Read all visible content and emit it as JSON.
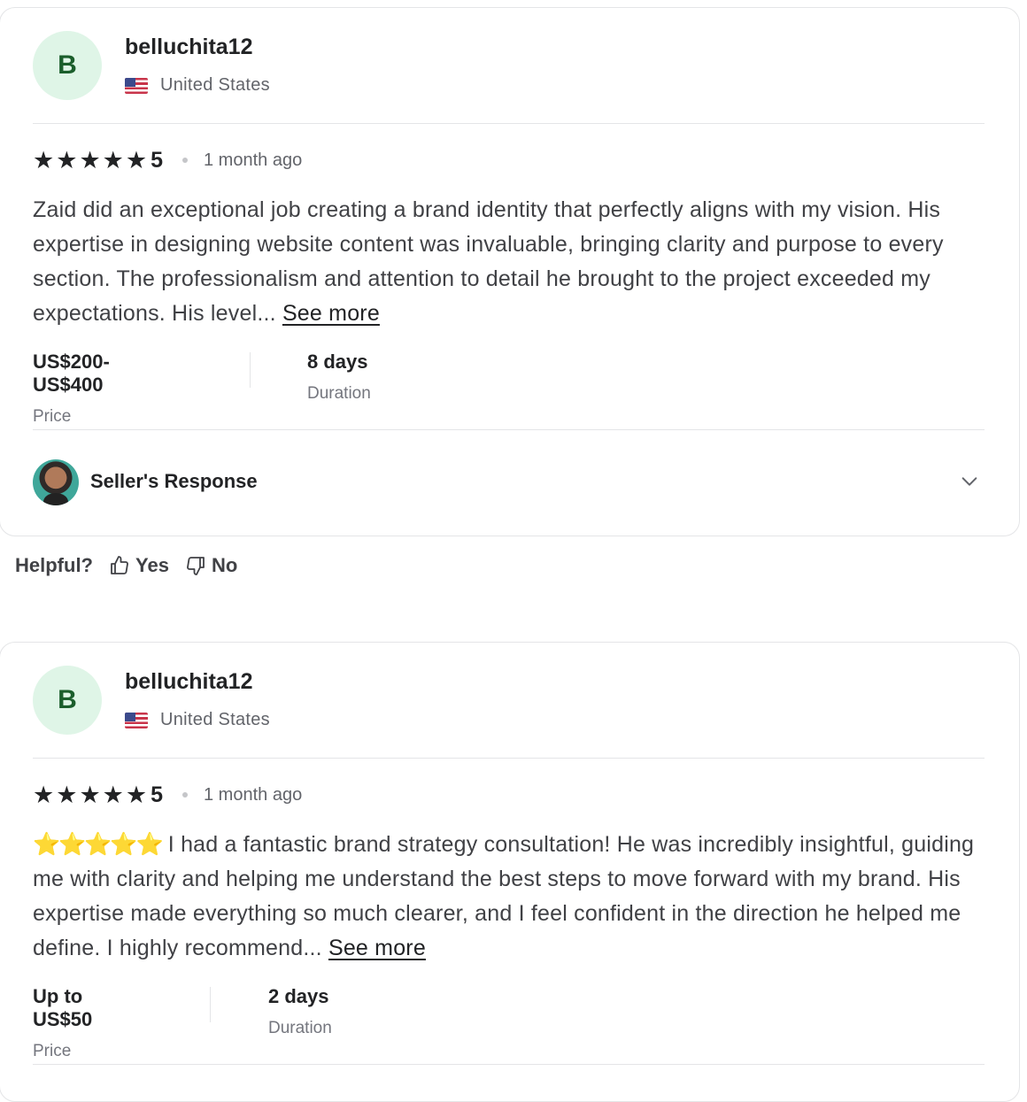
{
  "reviews": [
    {
      "avatar_letter": "B",
      "username": "belluchita12",
      "country": "United States",
      "rating": "5",
      "time_ago": "1 month ago",
      "text": "Zaid did an exceptional job creating a brand identity that perfectly aligns with my vision. His expertise in designing website content was invaluable, bringing clarity and purpose to every section. The professionalism and attention to detail he brought to the project exceeded my expectations. His level...",
      "see_more": "See more",
      "price_value": "US$200-US$400",
      "price_label": "Price",
      "duration_value": "8 days",
      "duration_label": "Duration",
      "seller_response_label": "Seller's Response"
    },
    {
      "avatar_letter": "B",
      "username": "belluchita12",
      "country": "United States",
      "rating": "5",
      "time_ago": "1 month ago",
      "text_emoji": "⭐⭐⭐⭐⭐",
      "text": " I had a fantastic brand strategy consultation! He was incredibly insightful, guiding me with clarity and helping me understand the best steps to move forward with my brand. His expertise made everything so much clearer, and I feel confident in the direction he helped me define. I highly recommend...",
      "see_more": "See more",
      "price_value": "Up to US$50",
      "price_label": "Price",
      "duration_value": "2 days",
      "duration_label": "Duration"
    }
  ],
  "helpful": {
    "label": "Helpful?",
    "yes": "Yes",
    "no": "No"
  },
  "icons": {
    "flag": "us-flag-icon",
    "star": "star-icon",
    "chevron": "chevron-down-icon",
    "thumbs_up": "thumbs-up-icon",
    "thumbs_down": "thumbs-down-icon"
  },
  "colors": {
    "avatar_bg": "#dff5e7",
    "avatar_text": "#1b5e2c",
    "text_primary": "#222325",
    "text_secondary": "#62646a"
  }
}
